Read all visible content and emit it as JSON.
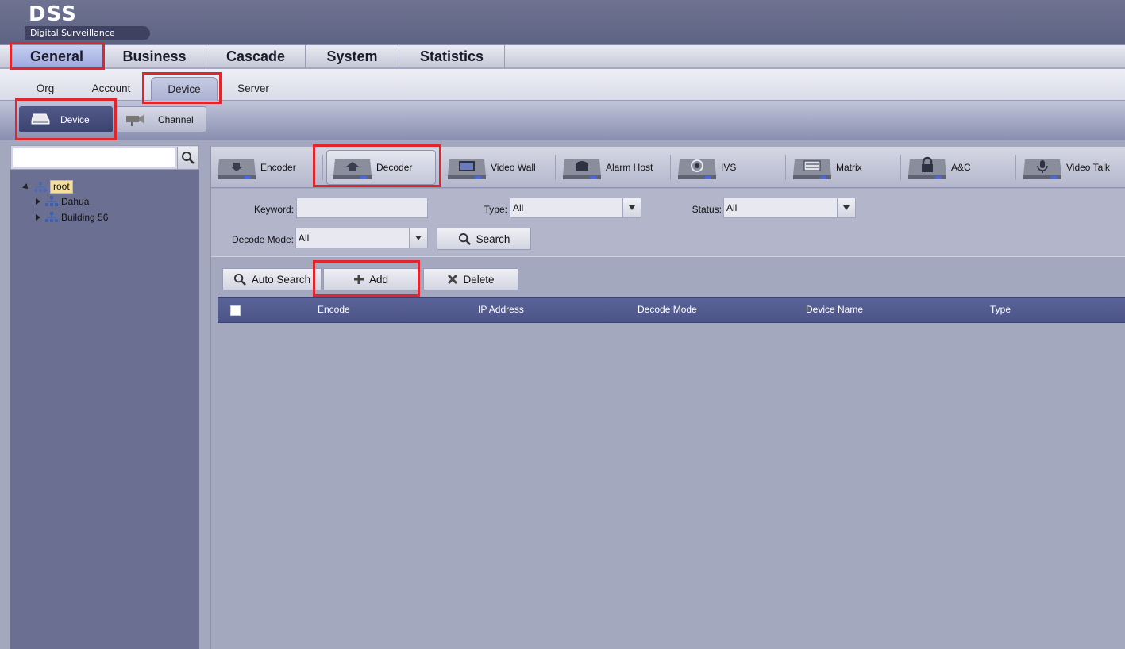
{
  "app": {
    "logo": "DSS",
    "subtitle": "Digital Surveillance System"
  },
  "main_nav": [
    "General",
    "Business",
    "Cascade",
    "System",
    "Statistics"
  ],
  "sub_nav": [
    "Org",
    "Account",
    "Device",
    "Server"
  ],
  "third_nav": [
    "Device",
    "Channel"
  ],
  "tree": {
    "root": "root",
    "children": [
      "Dahua",
      "Building 56"
    ]
  },
  "device_types": [
    "Encoder",
    "Decoder",
    "Video Wall",
    "Alarm Host",
    "IVS",
    "Matrix",
    "A&C",
    "Video Talk"
  ],
  "filters": {
    "keyword_label": "Keyword:",
    "keyword_value": "",
    "type_label": "Type:",
    "type_value": "All",
    "status_label": "Status:",
    "status_value": "All",
    "decode_mode_label": "Decode Mode:",
    "decode_mode_value": "All",
    "search_button": "Search"
  },
  "actions": {
    "auto_search": "Auto Search",
    "add": "Add",
    "delete": "Delete"
  },
  "table": {
    "columns": [
      "Encode",
      "IP Address",
      "Decode Mode",
      "Device Name",
      "Type"
    ],
    "rows": []
  },
  "colors": {
    "highlight": "#e0252d",
    "table_header": "#5a6398",
    "panel_bg": "#6b6f92",
    "content_bg": "#a4a8be"
  }
}
